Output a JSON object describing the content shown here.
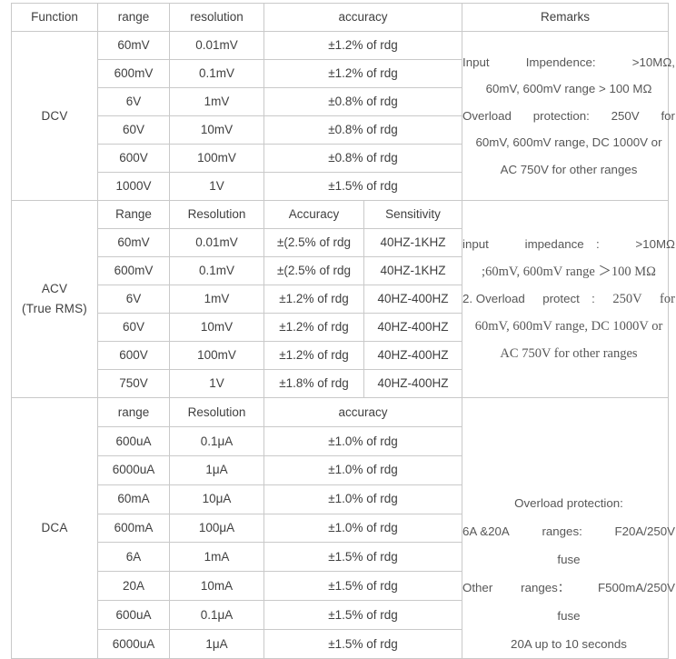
{
  "document": {
    "type": "specification-table",
    "title": "Digital Multimeter Measurement Specifications"
  },
  "table": {
    "headers": {
      "function": "Function",
      "range": "range",
      "resolution": "resolution",
      "accuracy": "accuracy",
      "remarks": "Remarks"
    },
    "sections": [
      {
        "id": "dcv",
        "function_label": "DCV",
        "function_sublabel": "",
        "subheaders": [
          "range",
          "resolution",
          "accuracy"
        ],
        "has_sensitivity": false,
        "rows": [
          {
            "range": "60mV",
            "resolution": "0.01mV",
            "accuracy": "±1.2% of rdg"
          },
          {
            "range": "600mV",
            "resolution": "0.1mV",
            "accuracy": "±1.2% of rdg"
          },
          {
            "range": "6V",
            "resolution": "1mV",
            "accuracy": "±0.8% of rdg"
          },
          {
            "range": "60V",
            "resolution": "10mV",
            "accuracy": "±0.8% of rdg"
          },
          {
            "range": "600V",
            "resolution": "100mV",
            "accuracy": "±0.8% of rdg"
          },
          {
            "range": "1000V",
            "resolution": "1V",
            "accuracy": "±1.5% of rdg"
          }
        ],
        "remarks": {
          "line1_left": "Input",
          "line1_mid": "Impendence:",
          "line1_right": ">10MΩ,",
          "line2": "60mV, 600mV range > 100 MΩ",
          "line3_left": "Overload",
          "line3_mid": "protection:",
          "line3_right1": "250V",
          "line3_right2": "for",
          "line4": "60mV, 600mV range, DC 1000V or",
          "line5": "AC 750V for other ranges"
        }
      },
      {
        "id": "acv",
        "function_label": "ACV",
        "function_sublabel": "(True RMS)",
        "subheaders": [
          "Range",
          "Resolution",
          "Accuracy",
          "Sensitivity"
        ],
        "has_sensitivity": true,
        "rows": [
          {
            "range": "60mV",
            "resolution": "0.01mV",
            "accuracy": "±(2.5% of rdg",
            "sensitivity": "40HZ-1KHZ"
          },
          {
            "range": "600mV",
            "resolution": "0.1mV",
            "accuracy": "±(2.5% of rdg",
            "sensitivity": "40HZ-1KHZ"
          },
          {
            "range": "6V",
            "resolution": "1mV",
            "accuracy": "±1.2% of rdg",
            "sensitivity": "40HZ-400HZ"
          },
          {
            "range": "60V",
            "resolution": "10mV",
            "accuracy": "±1.2% of rdg",
            "sensitivity": "40HZ-400HZ"
          },
          {
            "range": "600V",
            "resolution": "100mV",
            "accuracy": "±1.2% of rdg",
            "sensitivity": "40HZ-400HZ"
          },
          {
            "range": "750V",
            "resolution": "1V",
            "accuracy": "±1.8% of rdg",
            "sensitivity": "40HZ-400HZ"
          }
        ],
        "remarks": {
          "line1_left": "input",
          "line1_mid": "impedance　:",
          "line1_right": ">10MΩ",
          "line2": ";60mV, 600mV range ＞100 MΩ",
          "line3_left": "2. Overload",
          "line3_mid": "protect　:",
          "line3_right1": "250V",
          "line3_right2": "for",
          "line4": "60mV, 600mV range, DC 1000V or",
          "line5": "AC 750V for other ranges"
        }
      },
      {
        "id": "dca",
        "function_label": "DCA",
        "function_sublabel": "",
        "subheaders": [
          "range",
          "Resolution",
          "accuracy"
        ],
        "has_sensitivity": false,
        "rows": [
          {
            "range": "600uA",
            "resolution": "0.1μA",
            "accuracy": "±1.0% of rdg"
          },
          {
            "range": "6000uA",
            "resolution": "1μA",
            "accuracy": "±1.0% of rdg"
          },
          {
            "range": "60mA",
            "resolution": "10μA",
            "accuracy": "±1.0% of rdg"
          },
          {
            "range": "600mA",
            "resolution": "100μA",
            "accuracy": "±1.0% of rdg"
          },
          {
            "range": "6A",
            "resolution": "1mA",
            "accuracy": "±1.5% of rdg"
          },
          {
            "range": "20A",
            "resolution": "10mA",
            "accuracy": "±1.5% of rdg"
          },
          {
            "range": "600uA",
            "resolution": "0.1μA",
            "accuracy": "±1.5% of rdg"
          },
          {
            "range": "6000uA",
            "resolution": "1μA",
            "accuracy": "±1.5% of rdg"
          }
        ],
        "remarks": {
          "line1": "Overload protection:",
          "line2_left": "6A  &20A",
          "line2_mid": "ranges:",
          "line2_right": "F20A/250V",
          "line3": "fuse",
          "line4_left": "Other",
          "line4_mid": "ranges：",
          "line4_right": "F500mA/250V",
          "line5": "fuse",
          "line6": "20A up to 10 seconds"
        }
      }
    ]
  },
  "colors": {
    "grid_line": "#c9c9c9",
    "text": "#404040",
    "remarks_text": "#575757",
    "selected_cell_border": "#1a1a1a",
    "background": "#ffffff"
  }
}
